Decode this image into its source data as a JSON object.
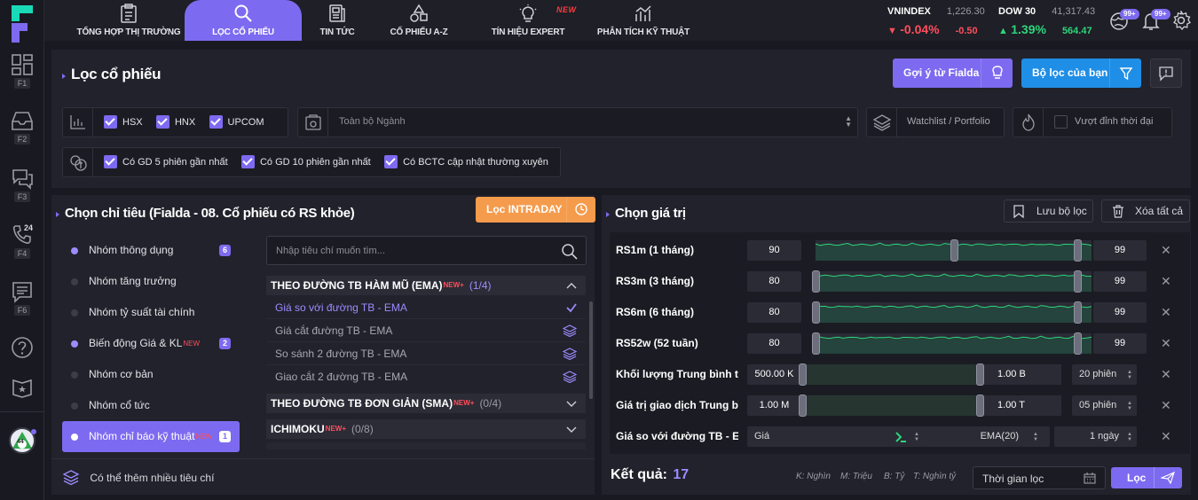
{
  "nav": {
    "tabs": [
      {
        "label": "TỔNG HỢP THỊ TRƯỜNG",
        "icon": "report-icon"
      },
      {
        "label": "LỌC CỔ PHIẾU",
        "icon": "search-icon"
      },
      {
        "label": "TIN TỨC",
        "icon": "news-icon"
      },
      {
        "label": "CỔ PHIẾU A-Z",
        "icon": "shapes-icon"
      },
      {
        "label": "TÍN HIỆU EXPERT",
        "icon": "bulb-icon",
        "flag": "NEW"
      },
      {
        "label": "PHÂN TÍCH KỸ THUẬT",
        "icon": "chart-icon"
      }
    ]
  },
  "indices": [
    {
      "name": "VNINDEX",
      "value": "1,226.30",
      "pct": "-0.04%",
      "change": "-0.50",
      "dir": "down"
    },
    {
      "name": "DOW 30",
      "value": "41,317.43",
      "pct": "1.39%",
      "change": "564.47",
      "dir": "up"
    }
  ],
  "notify": {
    "badge1": "99+",
    "badge2": "99+"
  },
  "sidebar": {
    "keys": [
      "F1",
      "F2",
      "F3",
      "F4",
      "F6"
    ],
    "phone_badge": "24",
    "avatar_num": "44"
  },
  "page": {
    "title": "Lọc cổ phiếu",
    "btn_suggest": "Gợi ý từ Fialda",
    "btn_myfilter": "Bộ lọc của bạn"
  },
  "filters": {
    "exchanges": [
      {
        "label": "HSX",
        "checked": true
      },
      {
        "label": "HNX",
        "checked": true
      },
      {
        "label": "UPCOM",
        "checked": true
      }
    ],
    "industry_placeholder": "Toàn bộ Ngành",
    "watchlist": "Watchlist / Portfolio",
    "peak": "Vượt đỉnh thời đại",
    "extra": [
      {
        "label": "Có GD 5 phiên gần nhất"
      },
      {
        "label": "Có GD 10 phiên gần nhất"
      },
      {
        "label": "Có BCTC cập nhật thường xuyên"
      }
    ]
  },
  "criteria": {
    "title": "Chọn chỉ tiêu (Fialda - 08. Cổ phiếu có RS khỏe)",
    "intraday": "Lọc INTRADAY",
    "search_placeholder": "Nhập tiêu chí muốn tìm...",
    "groups": [
      {
        "label": "Nhóm thông dụng",
        "count": "6",
        "active": true
      },
      {
        "label": "Nhóm tăng trưởng",
        "count": "",
        "active": false
      },
      {
        "label": "Nhóm tỷ suất tài chính",
        "count": "",
        "active": false
      },
      {
        "label": "Biến động Giá & KL",
        "count": "2",
        "active": true,
        "new": "NEW"
      },
      {
        "label": "Nhóm cơ bản",
        "count": "",
        "active": false
      },
      {
        "label": "Nhóm cổ tức",
        "count": "",
        "active": false
      },
      {
        "label": "Nhóm chỉ báo kỹ thuật",
        "count": "1",
        "active": true,
        "new": "NEW"
      }
    ],
    "sections": [
      {
        "title": "THEO ĐƯỜNG TB HÀM MŨ (EMA)",
        "new": "NEW+",
        "progress": "(1/4)"
      },
      {
        "title": "THEO ĐƯỜNG TB ĐƠN GIẢN (SMA)",
        "new": "NEW+",
        "progress": "(0/4)"
      },
      {
        "title": "ICHIMOKU",
        "new": "NEW+",
        "progress": "(0/8)"
      }
    ],
    "items": [
      "Giá so với đường TB - EMA",
      "Giá cắt đường TB - EMA",
      "So sánh 2 đường TB - EMA",
      "Giao cắt 2 đường TB - EMA"
    ],
    "more": "Có thể thêm nhiều tiêu chí"
  },
  "values": {
    "title": "Chọn giá trị",
    "save": "Lưu bộ lọc",
    "clear": "Xóa tất cả",
    "rows": [
      {
        "label": "RS1m (1 tháng)",
        "min": "90",
        "max": "99",
        "lo": 0.9,
        "hi": 0.99
      },
      {
        "label": "RS3m (3 tháng)",
        "min": "80",
        "max": "99",
        "lo": 0.8,
        "hi": 0.99
      },
      {
        "label": "RS6m (6 tháng)",
        "min": "80",
        "max": "99",
        "lo": 0.8,
        "hi": 0.99
      },
      {
        "label": "RS52w (52 tuần)",
        "min": "80",
        "max": "99",
        "lo": 0.8,
        "hi": 0.99
      },
      {
        "label": "Khối lượng Trung bình t...",
        "min": "500.00 K",
        "max": "1.00 B",
        "sel": "20 phiên"
      },
      {
        "label": "Giá trị giao dịch Trung bì...",
        "min": "1.00 M",
        "max": "1.00 T",
        "sel": "05 phiên"
      },
      {
        "label": "Giá so với đường TB - E...",
        "opt1": "Giá",
        "opt2": "EMA(20)",
        "opt3": "1 ngày"
      }
    ],
    "result_label": "Kết quả:",
    "result_count": "17",
    "units": [
      "K: Nghìn",
      "M: Triệu",
      "B: Tỷ",
      "T: Nghìn tỷ"
    ],
    "time_placeholder": "Thời gian lọc",
    "filter_btn": "Lọc"
  }
}
